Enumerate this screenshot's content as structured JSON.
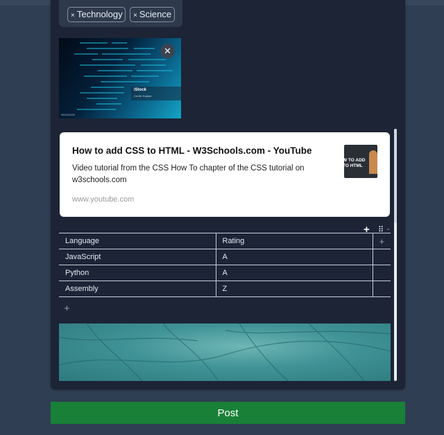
{
  "tags": [
    {
      "label": "Technology"
    },
    {
      "label": "Science"
    }
  ],
  "tag_remove_glyph": "×",
  "image_attachment": {
    "remove_glyph": "✕",
    "brand": "iStock",
    "brand_sub": "Credit: Kaptan",
    "credit": "960034300"
  },
  "link_preview": {
    "title": "How to add CSS to HTML - W3Schools.com - YouTube",
    "description": "Video tutorial from the CSS How To chapter of the CSS tutorial on w3schools.com",
    "url": "www.youtube.com",
    "thumbnail_text": "W TO ADD\nTO HTML"
  },
  "table": {
    "add_column_glyph": "+",
    "drag_glyph": "⠿",
    "menu_glyph": "-",
    "add_row_glyph": "+",
    "headers": [
      "Language",
      "Rating"
    ],
    "rows": [
      [
        "JavaScript",
        "A"
      ],
      [
        "Python",
        "A"
      ],
      [
        "Assembly",
        "Z"
      ]
    ]
  },
  "post_button": {
    "label": "Post"
  },
  "colors": {
    "background": "#2f3e52",
    "panel": "#1c2436",
    "post_button": "#198038"
  }
}
